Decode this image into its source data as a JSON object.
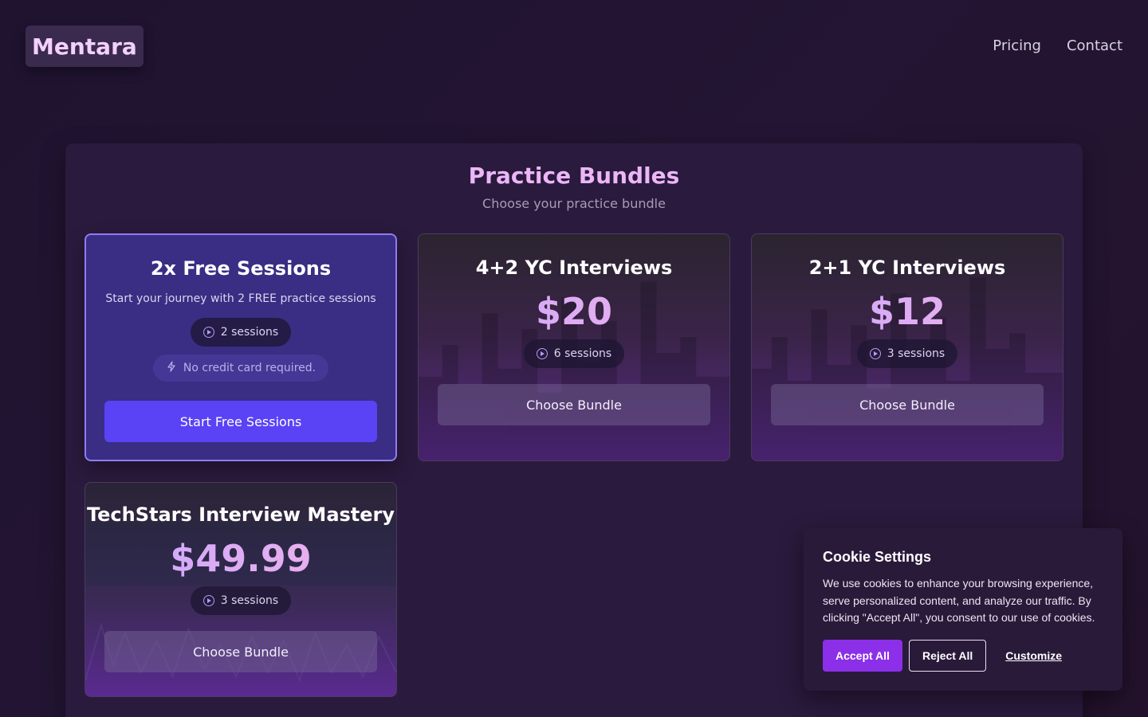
{
  "brand": {
    "logo": "Mentara"
  },
  "nav": {
    "items": [
      "Pricing",
      "Contact"
    ]
  },
  "section": {
    "title": "Practice Bundles",
    "subtitle": "Choose your practice bundle"
  },
  "cards": [
    {
      "title": "2x Free Sessions",
      "description": "Start your journey with 2 FREE practice sessions",
      "sessions": "2 sessions",
      "note": "No credit card required.",
      "button": "Start Free Sessions"
    },
    {
      "title": "4+2 YC Interviews",
      "price": "$20",
      "sessions": "6 sessions",
      "button": "Choose Bundle"
    },
    {
      "title": "2+1 YC Interviews",
      "price": "$12",
      "sessions": "3 sessions",
      "button": "Choose Bundle"
    },
    {
      "title": "TechStars Interview Mastery",
      "price": "$49.99",
      "sessions": "3 sessions",
      "button": "Choose Bundle"
    }
  ],
  "cookie": {
    "title": "Cookie Settings",
    "text": "We use cookies to enhance your browsing experience, serve personalized content, and analyze our traffic. By clicking \"Accept All\", you consent to our use of cookies.",
    "accept": "Accept All",
    "reject": "Reject All",
    "customize": "Customize"
  },
  "colors": {
    "accent": "#5a42f5",
    "cookie_accent": "#8b2fe8",
    "title": "#ecb6f7"
  }
}
